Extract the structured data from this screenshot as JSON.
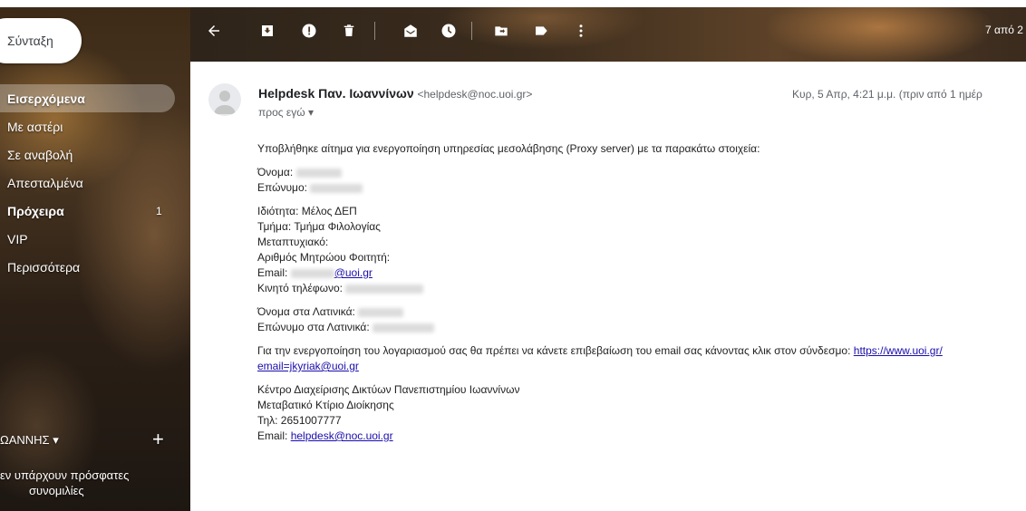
{
  "sidebar": {
    "compose_label": "Σύνταξη",
    "items": [
      {
        "label": "Εισερχόμενα",
        "count": ""
      },
      {
        "label": "Με αστέρι",
        "count": ""
      },
      {
        "label": "Σε αναβολή",
        "count": ""
      },
      {
        "label": "Απεσταλμένα",
        "count": ""
      },
      {
        "label": "Πρόχειρα",
        "count": "1"
      },
      {
        "label": "VIP",
        "count": ""
      },
      {
        "label": "Περισσότερα",
        "count": ""
      }
    ],
    "hangouts": {
      "user": "ΩΑΝΝΗΣ ▾",
      "plus": "+",
      "empty_line1": "εν υπάρχουν πρόσφατες",
      "empty_line2": "συνομιλίες"
    }
  },
  "toolbar": {
    "page_info": "7 από 2"
  },
  "email": {
    "sender_name": "Helpdesk Παν. Ιωαννίνων",
    "sender_address": "<helpdesk@noc.uoi.gr>",
    "date": "Κυρ, 5 Απρ, 4:21 μ.μ. (πριν από 1 ημέρ",
    "to": "προς εγώ ▾",
    "intro": "Υποβλήθηκε αίτημα για ενεργοποίηση υπηρεσίας μεσολάβησης (Proxy server) με τα παρακάτω στοιχεία:",
    "name_label": "Όνομα:",
    "surname_label": "Επώνυμο:",
    "property": "Ιδιότητα: Μέλος ΔΕΠ",
    "department": "Τμήμα: Τμήμα Φιλολογίας",
    "postgrad": "Μεταπτυχιακό:",
    "student_id": "Αριθμός Μητρώου Φοιτητή:",
    "email_label": "Email:",
    "email_domain": "@uoi.gr",
    "mobile_label": "Κινητό τηλέφωνο:",
    "latin_name_label": "Όνομα στα Λατινικά:",
    "latin_surname_label": "Επώνυμο στα Λατινικά:",
    "activation_text": "Για την ενεργοποίηση του λογαριασμού σας θα πρέπει να κάνετε επιβεβαίωση του email σας κάνοντας κλικ στον σύνδεσμο:",
    "activation_link": "https://www.uoi.gr/",
    "activation_link2": "email=jkyriak@uoi.gr",
    "sig_org": "Κέντρο Διαχείρισης Δικτύων Πανεπιστημίου Ιωαννίνων",
    "sig_building": "Μεταβατικό Κτίριο Διοίκησης",
    "sig_phone": "Τηλ: 2651007777",
    "sig_email_label": "Email:",
    "sig_email": "helpdesk@noc.uoi.gr"
  }
}
